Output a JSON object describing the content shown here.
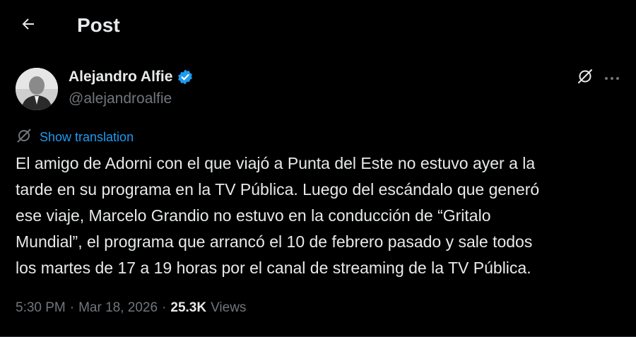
{
  "header": {
    "title": "Post",
    "back_icon": "arrow-left-icon"
  },
  "author": {
    "name": "Alejandro Alfie",
    "handle": "@alejandroalfie",
    "verified": true,
    "verified_color": "#1d9bf0"
  },
  "post": {
    "show_translation_label": "Show translation",
    "lines": [
      "El amigo de Adorni con el que viajó a Punta del Este no estuvo ayer a la",
      "tarde en su programa en la TV Pública. Luego del escándalo que generó",
      "ese viaje, Marcelo Grandio no estuvo en la conducción de “Gritalo",
      "Mundial”, el programa que arrancó el 10 de febrero pasado y sale todos",
      "los martes de 17 a 19 horas por el canal de streaming de la TV Pública."
    ],
    "time": "5:30 PM",
    "date": "Mar 18, 2026",
    "views_count": "25.3K",
    "views_label": "Views"
  },
  "colors": {
    "background": "#000000",
    "text": "#e7e9ea",
    "secondary_text": "#71767b",
    "link": "#1d9bf0"
  }
}
